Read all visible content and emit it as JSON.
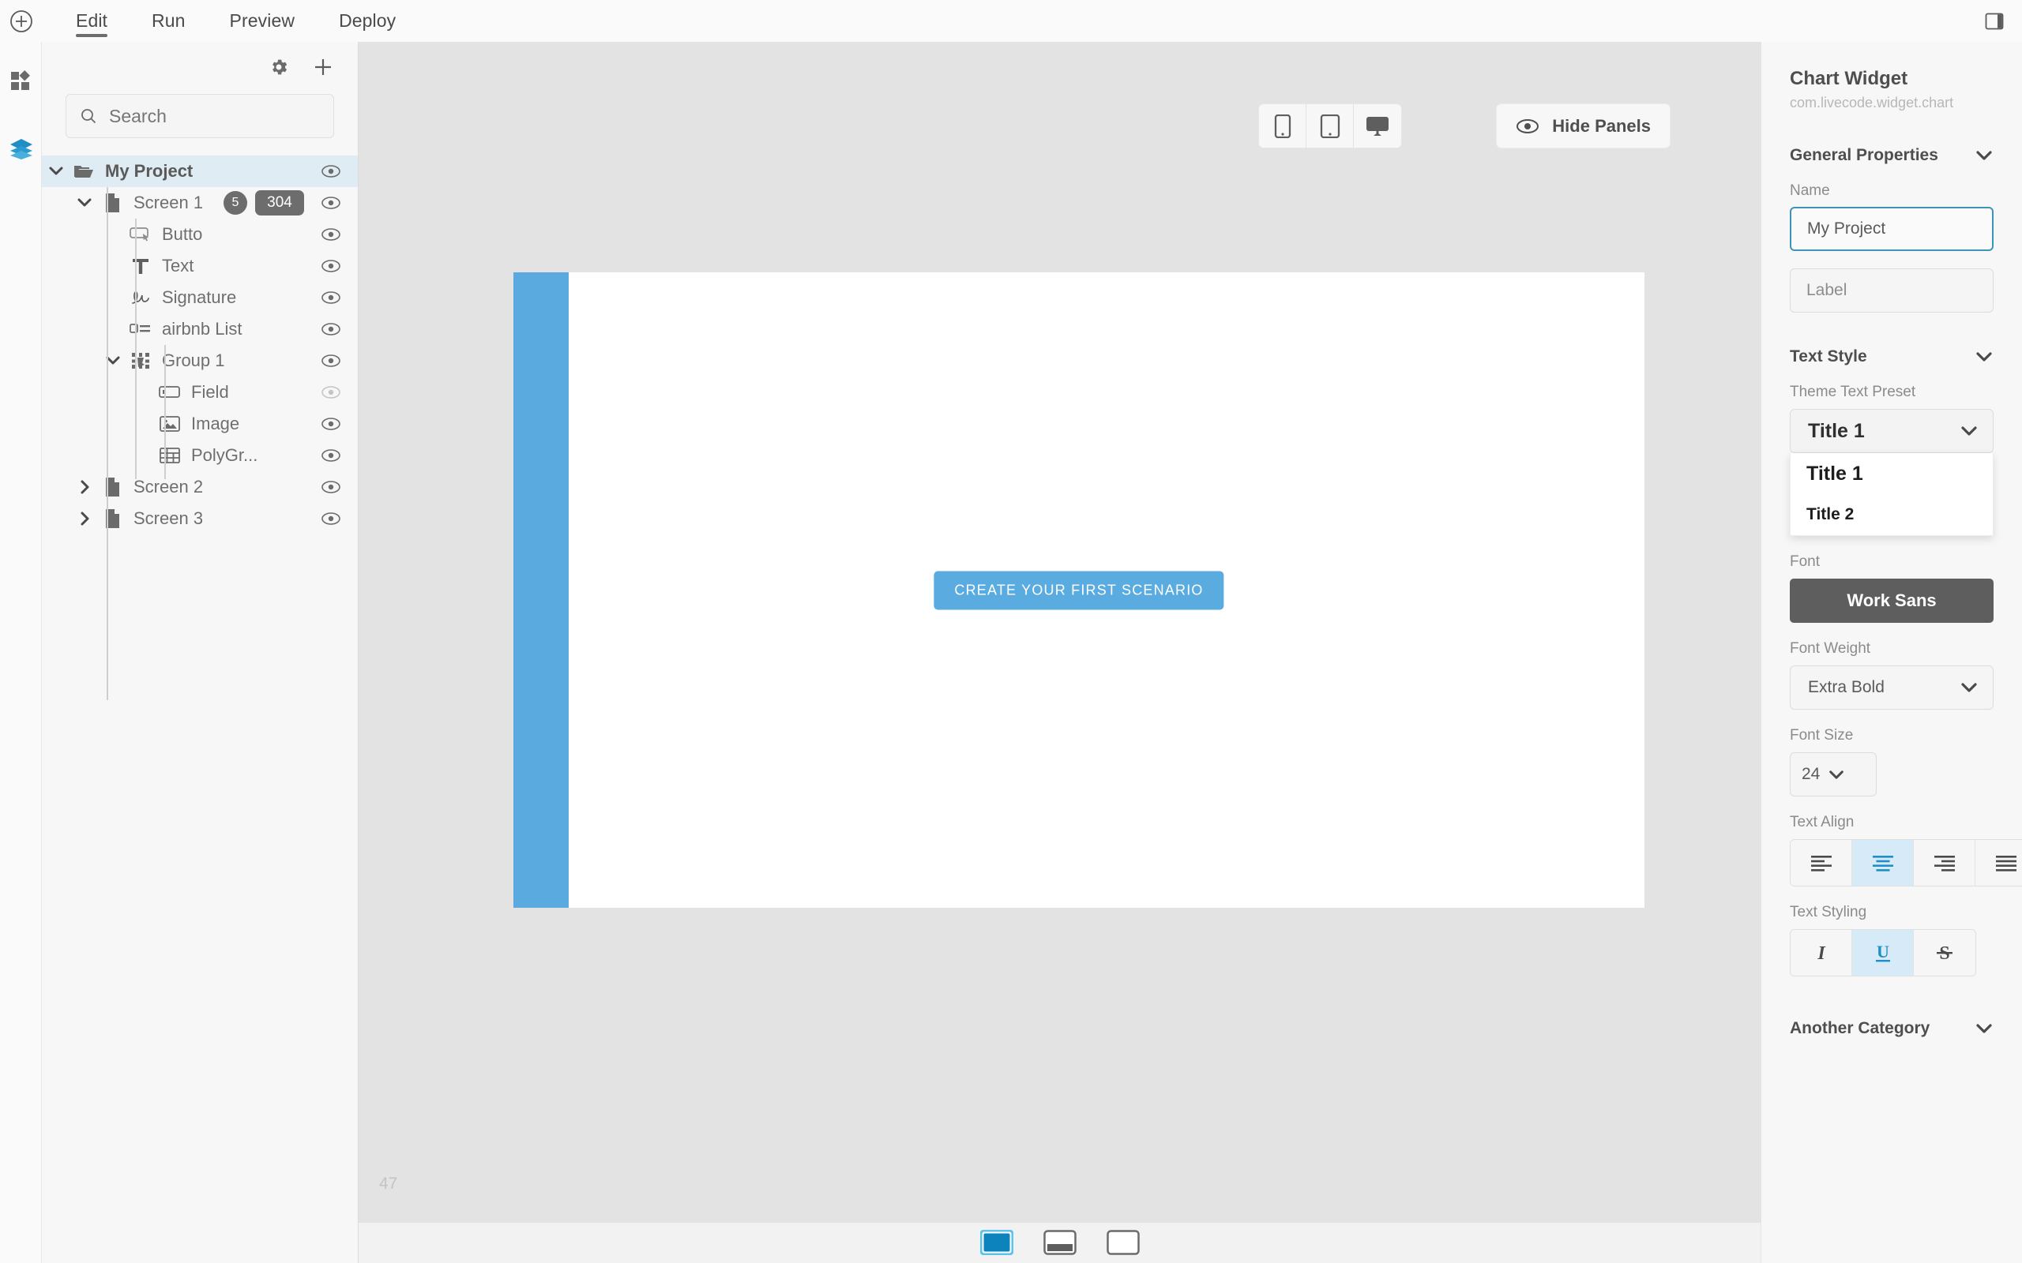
{
  "topbar": {
    "add_icon": "plus-circle-icon",
    "menu": [
      {
        "label": "Edit",
        "active": true
      },
      {
        "label": "Run",
        "active": false
      },
      {
        "label": "Preview",
        "active": false
      },
      {
        "label": "Deploy",
        "active": false
      }
    ],
    "panel_toggle_icon": "right-panel-toggle-icon"
  },
  "rail": {
    "items": [
      {
        "icon": "widgets-grid-icon",
        "active": false
      },
      {
        "icon": "layers-stack-icon",
        "active": true
      }
    ]
  },
  "project_panel": {
    "gear_icon": "gear-icon",
    "add_icon": "plus-icon",
    "search": {
      "value": "",
      "placeholder": "Search",
      "icon": "search-icon"
    },
    "tree": [
      {
        "label": "My Project",
        "icon": "folder-icon",
        "depth": 0,
        "expanded": true,
        "selected": true,
        "bold": true,
        "eye": true
      },
      {
        "label": "Screen 1",
        "icon": "file-icon",
        "depth": 1,
        "expanded": true,
        "selected": false,
        "bold": false,
        "eye": true,
        "badge_count": "5",
        "badge_pill": "304"
      },
      {
        "label": "Butto",
        "icon": "button-icon",
        "depth": 2,
        "expanded": null,
        "selected": false,
        "bold": false,
        "eye": true
      },
      {
        "label": "Text",
        "icon": "text-icon",
        "depth": 2,
        "expanded": null,
        "selected": false,
        "bold": false,
        "eye": true
      },
      {
        "label": "Signature",
        "icon": "signature-icon",
        "depth": 2,
        "expanded": null,
        "selected": false,
        "bold": false,
        "eye": true
      },
      {
        "label": "airbnb List",
        "icon": "list-icon",
        "depth": 2,
        "expanded": null,
        "selected": false,
        "bold": false,
        "eye": true
      },
      {
        "label": "Group 1",
        "icon": "group-icon",
        "depth": 2,
        "expanded": true,
        "selected": false,
        "bold": false,
        "eye": true
      },
      {
        "label": "Field",
        "icon": "field-icon",
        "depth": 3,
        "expanded": null,
        "selected": false,
        "bold": false,
        "eye": false
      },
      {
        "label": "Image",
        "icon": "image-icon",
        "depth": 3,
        "expanded": null,
        "selected": false,
        "bold": false,
        "eye": true
      },
      {
        "label": "PolyGr...",
        "icon": "table-icon",
        "depth": 3,
        "expanded": null,
        "selected": false,
        "bold": false,
        "eye": true
      },
      {
        "label": "Screen 2",
        "icon": "file-icon",
        "depth": 1,
        "expanded": false,
        "selected": false,
        "bold": false,
        "eye": true
      },
      {
        "label": "Screen 3",
        "icon": "file-icon",
        "depth": 1,
        "expanded": false,
        "selected": false,
        "bold": false,
        "eye": true
      }
    ]
  },
  "canvas": {
    "devices": [
      {
        "icon": "phone-icon",
        "active": false
      },
      {
        "icon": "tablet-icon",
        "active": false
      },
      {
        "icon": "desktop-icon",
        "active": false
      }
    ],
    "hide_panels": {
      "label": "Hide Panels",
      "icon": "eye-icon"
    },
    "scenario_button": "CREATE YOUR FIRST SCENARIO",
    "zoom_level": "47",
    "strip_color": "#5aaadf",
    "button_color": "#5aabdf",
    "layout_modes": [
      {
        "icon": "layout-full-icon",
        "active": true
      },
      {
        "icon": "layout-split-icon",
        "active": false
      },
      {
        "icon": "layout-empty-icon",
        "active": false
      }
    ]
  },
  "properties": {
    "title": "Chart Widget",
    "subtitle": "com.livecode.widget.chart",
    "general": {
      "section_label": "General Properties",
      "chevron_icon": "chevron-down-icon",
      "name_label": "Name",
      "name_value": "My Project",
      "label_label": "Label",
      "label_placeholder": "Label",
      "label_value": ""
    },
    "text_style": {
      "section_label": "Text Style",
      "chevron_icon": "chevron-down-icon",
      "preset_label": "Theme Text Preset",
      "preset_value": "Title 1",
      "preset_options": [
        "Title 1",
        "Title 2"
      ],
      "font_label": "Font",
      "font_value": "Work Sans",
      "weight_label": "Font Weight",
      "weight_value": "Extra Bold",
      "size_label": "Font Size",
      "size_value": "24",
      "align_label": "Text Align",
      "align_options": [
        {
          "icon": "align-left-icon",
          "active": false
        },
        {
          "icon": "align-center-icon",
          "active": true
        },
        {
          "icon": "align-right-icon",
          "active": false
        },
        {
          "icon": "align-justify-icon",
          "active": false
        }
      ],
      "styling_label": "Text Styling",
      "styling_options": [
        {
          "icon": "italic-icon",
          "glyph": "I",
          "active": false
        },
        {
          "icon": "underline-icon",
          "glyph": "U",
          "active": true
        },
        {
          "icon": "strikethrough-icon",
          "glyph": "S",
          "active": false
        }
      ]
    },
    "another_category": {
      "section_label": "Another Category",
      "chevron_icon": "chevron-down-icon"
    },
    "accent_color": "#1e8ec4"
  }
}
